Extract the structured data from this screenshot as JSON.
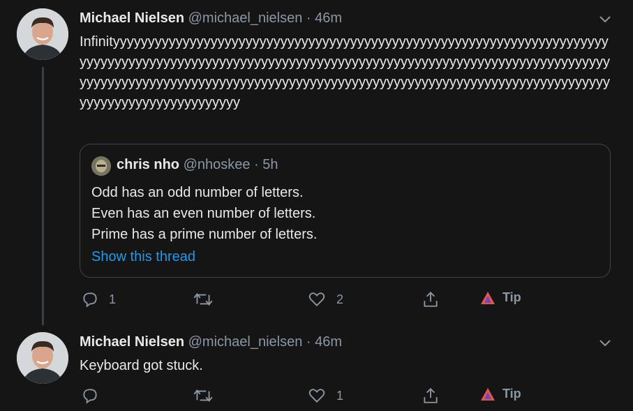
{
  "tweets": [
    {
      "name": "Michael Nielsen",
      "handle": "@michael_nielsen",
      "sep": "·",
      "time": "46m",
      "text": "Infinityyyyyyyyyyyyyyyyyyyyyyyyyyyyyyyyyyyyyyyyyyyyyyyyyyyyyyyyyyyyyyyyyyyyyyyyyyyyyyyyyyyyyyyyyyyyyyyyyyyyyyyyyyyyyyyyyyyyyyyyyyyyyyyyyyyyyyyyyyyyyyyyyyyyyyyyyyyyyyyyyyyyyyyyyyyyyyyyyyyyyyyyyyyyyyyyyyyyyyyyyyyyyyyyyyyyyyyyyyyyyyyyyyyyyyyyyyyyyyyyyyyyyy",
      "quote": {
        "name": "chris nho",
        "handle": "@nhoskee",
        "sep": "·",
        "time": "5h",
        "lines": [
          "Odd has an odd number of letters.",
          "Even has an even number of letters.",
          "Prime has a prime number of letters."
        ],
        "link": "Show this thread"
      },
      "actions": {
        "replies": "1",
        "retweets": "",
        "likes": "2",
        "tip": "Tip"
      }
    },
    {
      "name": "Michael Nielsen",
      "handle": "@michael_nielsen",
      "sep": "·",
      "time": "46m",
      "text": "Keyboard got stuck.",
      "actions": {
        "replies": "",
        "retweets": "",
        "likes": "1",
        "tip": "Tip"
      }
    }
  ],
  "colors": {
    "background": "#151515",
    "link": "#1d9bf0",
    "muted": "#8b98a5",
    "border": "#3e4449"
  },
  "icons": [
    "reply-icon",
    "retweet-icon",
    "like-icon",
    "share-icon",
    "brave-tip-icon",
    "chevron-down-icon"
  ]
}
